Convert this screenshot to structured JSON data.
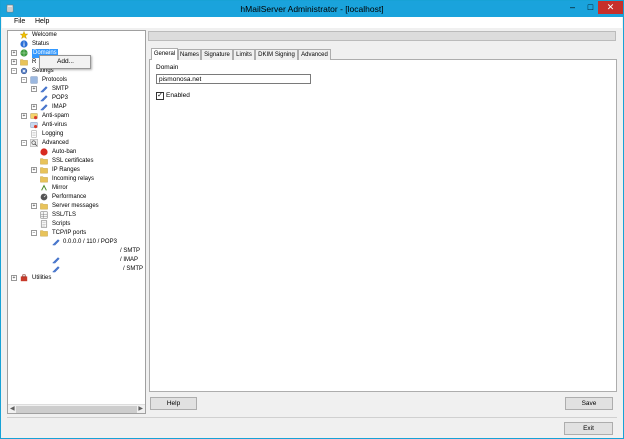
{
  "window": {
    "title": "hMailServer Administrator - [localhost]",
    "minimize": "–",
    "maximize": "□",
    "close": "✕"
  },
  "menu": {
    "file": "File",
    "help": "Help"
  },
  "tree": {
    "welcome": "Welcome",
    "status": "Status",
    "domains": "Domains",
    "rules": "R",
    "settings": "Settings",
    "protocols": "Protocols",
    "smtp": "SMTP",
    "pop3": "POP3",
    "imap": "IMAP",
    "antispam": "Anti-spam",
    "antivirus": "Anti-virus",
    "logging": "Logging",
    "advanced": "Advanced",
    "autoban": "Auto-ban",
    "ssl_certificates": "SSL certificates",
    "ip_ranges": "IP Ranges",
    "incoming_relays": "Incoming relays",
    "mirror": "Mirror",
    "performance": "Performance",
    "server_messages": "Server messages",
    "ssl_tls": "SSL/TLS",
    "scripts": "Scripts",
    "tcpip_ports": "TCP/IP ports",
    "port1": "0.0.0.0 / 110 / POP3",
    "port2": "/ SMTP",
    "port3": "/ IMAP",
    "port4": "/ SMTP",
    "utilities": "Utilities"
  },
  "context_menu": {
    "add": "Add..."
  },
  "tabs": [
    "General",
    "Names",
    "Signature",
    "Limits",
    "DKIM Signing",
    "Advanced"
  ],
  "general": {
    "domain_label": "Domain",
    "domain_value": "pismonosa.net",
    "enabled_label": "Enabled",
    "enabled": true
  },
  "buttons": {
    "help": "Help",
    "save": "Save",
    "exit": "Exit"
  },
  "colors": {
    "titlebar": "#1aa3dc",
    "close": "#c7302b",
    "selection": "#3399ff"
  }
}
